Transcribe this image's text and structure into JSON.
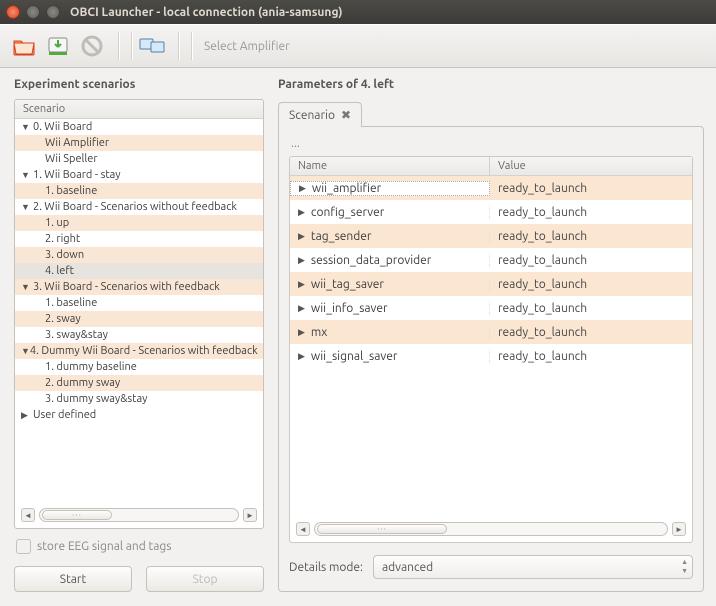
{
  "window": {
    "title": "OBCI Launcher - local connection (ania-samsung)"
  },
  "toolbar": {
    "select_amplifier": "Select Amplifier"
  },
  "left": {
    "title": "Experiment scenarios",
    "tree_header": "Scenario",
    "tree": [
      {
        "label": "0. Wii Board",
        "depth": 0,
        "expanded": true,
        "alt": false
      },
      {
        "label": "Wii Amplifier",
        "depth": 1,
        "alt": true
      },
      {
        "label": "Wii Speller",
        "depth": 1,
        "alt": false
      },
      {
        "label": "1. Wii Board - stay",
        "depth": 0,
        "expanded": true,
        "alt": false
      },
      {
        "label": "1. baseline",
        "depth": 1,
        "alt": true
      },
      {
        "label": "2. Wii Board - Scenarios without feedback",
        "depth": 0,
        "expanded": true,
        "alt": false
      },
      {
        "label": "1. up",
        "depth": 1,
        "alt": true
      },
      {
        "label": "2. right",
        "depth": 1,
        "alt": false
      },
      {
        "label": "3. down",
        "depth": 1,
        "alt": true
      },
      {
        "label": "4. left",
        "depth": 1,
        "alt": false,
        "selected": true
      },
      {
        "label": "3. Wii Board - Scenarios with feedback",
        "depth": 0,
        "expanded": true,
        "alt": true
      },
      {
        "label": "1. baseline",
        "depth": 1,
        "alt": false
      },
      {
        "label": "2. sway",
        "depth": 1,
        "alt": true
      },
      {
        "label": "3. sway&stay",
        "depth": 1,
        "alt": false
      },
      {
        "label": "4. Dummy Wii Board - Scenarios with feedback",
        "depth": 0,
        "expanded": true,
        "alt": true
      },
      {
        "label": "1. dummy baseline",
        "depth": 1,
        "alt": false
      },
      {
        "label": "2. dummy sway",
        "depth": 1,
        "alt": true
      },
      {
        "label": "3. dummy sway&stay",
        "depth": 1,
        "alt": false
      },
      {
        "label": "User defined",
        "depth": 0,
        "expanded": false,
        "alt": false
      }
    ],
    "store_label": "store EEG signal and tags",
    "start": "Start",
    "stop": "Stop"
  },
  "right": {
    "title": "Parameters of 4. left",
    "tab_label": "Scenario",
    "crumb": "...",
    "col_name": "Name",
    "col_value": "Value",
    "rows": [
      {
        "name": "wii_amplifier",
        "value": "ready_to_launch",
        "sel": true
      },
      {
        "name": "config_server",
        "value": "ready_to_launch"
      },
      {
        "name": "tag_sender",
        "value": "ready_to_launch"
      },
      {
        "name": "session_data_provider",
        "value": "ready_to_launch"
      },
      {
        "name": "wii_tag_saver",
        "value": "ready_to_launch"
      },
      {
        "name": "wii_info_saver",
        "value": "ready_to_launch"
      },
      {
        "name": "mx",
        "value": "ready_to_launch"
      },
      {
        "name": "wii_signal_saver",
        "value": "ready_to_launch"
      }
    ],
    "details_label": "Details mode:",
    "details_value": "advanced"
  }
}
